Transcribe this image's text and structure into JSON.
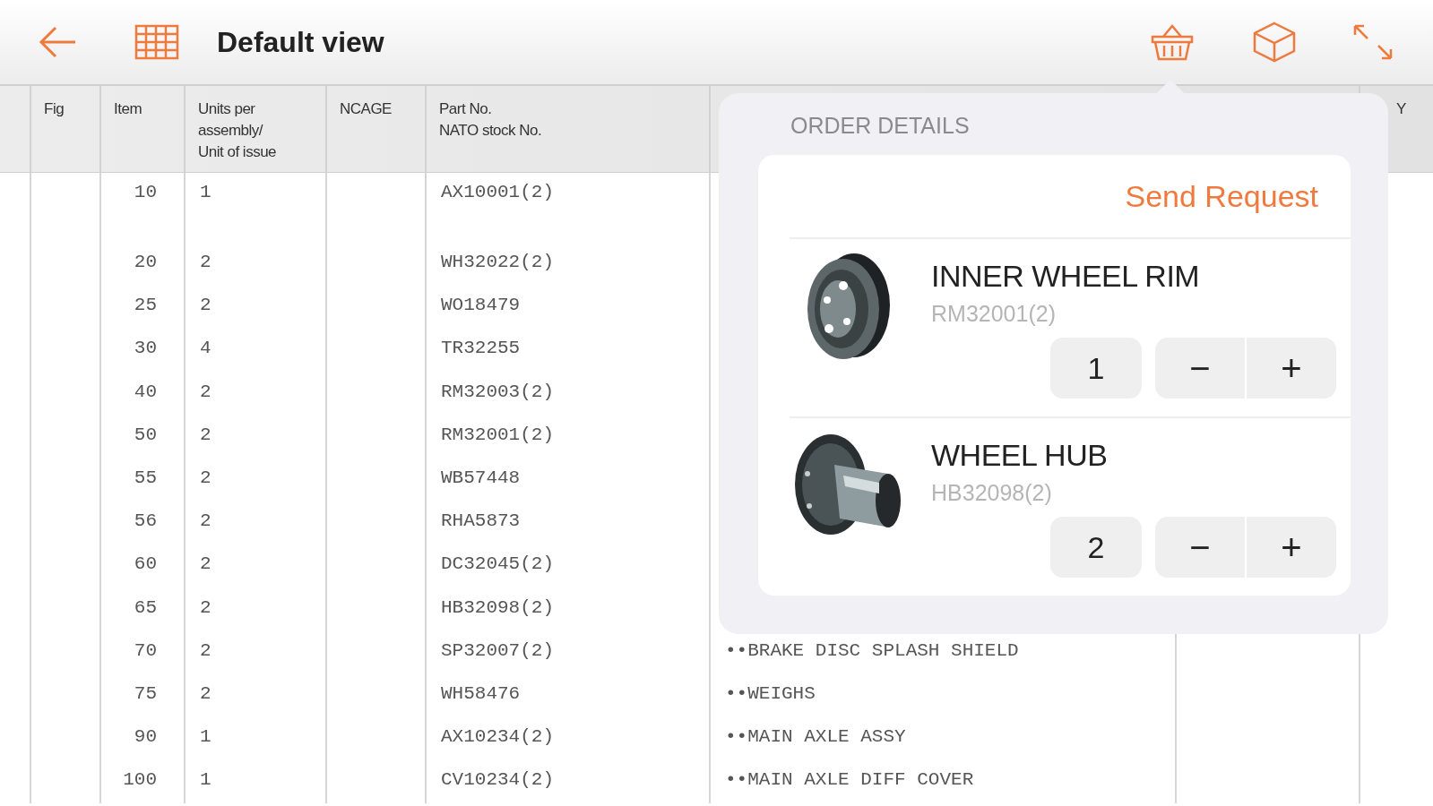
{
  "toolbar": {
    "title": "Default view"
  },
  "table": {
    "header": {
      "fig": "Fig",
      "item": "Item",
      "units": [
        "Units per",
        "assembly/",
        "Unit of issue"
      ],
      "ncage": "NCAGE",
      "part_no": [
        "Part No.",
        "NATO stock No."
      ],
      "column_9": "Y"
    },
    "rows": [
      {
        "item": "10",
        "units": "1",
        "part_no": "AX10001(2)"
      },
      {
        "item": "20",
        "units": "2",
        "part_no": "WH32022(2)"
      },
      {
        "item": "25",
        "units": "2",
        "part_no": "WO18479"
      },
      {
        "item": "30",
        "units": "4",
        "part_no": "TR32255"
      },
      {
        "item": "40",
        "units": "2",
        "part_no": "RM32003(2)"
      },
      {
        "item": "50",
        "units": "2",
        "part_no": "RM32001(2)"
      },
      {
        "item": "55",
        "units": "2",
        "part_no": "WB57448"
      },
      {
        "item": "56",
        "units": "2",
        "part_no": "RHA5873"
      },
      {
        "item": "60",
        "units": "2",
        "part_no": "DC32045(2)"
      },
      {
        "item": "65",
        "units": "2",
        "part_no": "HB32098(2)"
      },
      {
        "item": "70",
        "units": "2",
        "part_no": "SP32007(2)",
        "description": "••BRAKE DISC SPLASH SHIELD"
      },
      {
        "item": "75",
        "units": "2",
        "part_no": "WH58476",
        "description": "••WEIGHS"
      },
      {
        "item": "90",
        "units": "1",
        "part_no": "AX10234(2)",
        "description": "••MAIN AXLE ASSY"
      },
      {
        "item": "100",
        "units": "1",
        "part_no": "CV10234(2)",
        "description": "••MAIN AXLE DIFF COVER"
      }
    ]
  },
  "order_details": {
    "title": "ORDER DETAILS",
    "send_button": "Send Request",
    "items": [
      {
        "kind": "rim",
        "name": "INNER WHEEL RIM",
        "code": "RM32001(2)",
        "quantity": "1",
        "minus": "−",
        "plus": "+"
      },
      {
        "kind": "hub",
        "name": "WHEEL HUB",
        "code": "HB32098(2)",
        "quantity": "2",
        "minus": "−",
        "plus": "+"
      }
    ]
  }
}
